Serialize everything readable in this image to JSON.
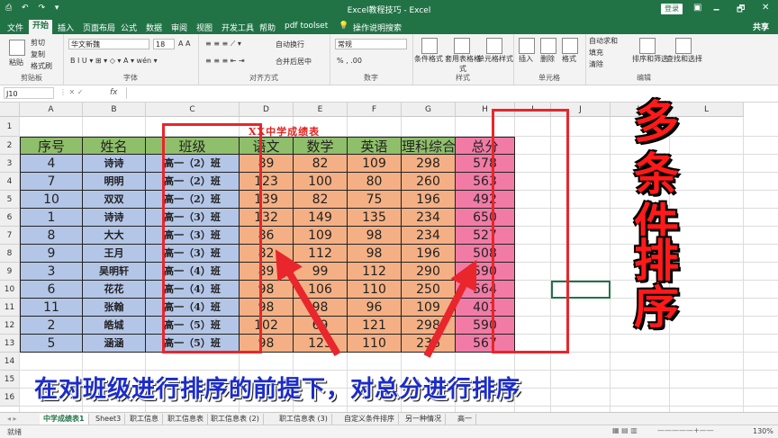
{
  "window": {
    "title": "Excel教程技巧 - Excel",
    "login": "登录",
    "quick_access": "⎙ ↶ ↷ ▾",
    "controls": [
      "🗕",
      "🗗",
      "✕"
    ]
  },
  "ribbon_tabs": [
    "文件",
    "开始",
    "插入",
    "页面布局",
    "公式",
    "数据",
    "审阅",
    "视图",
    "开发工具",
    "帮助",
    "pdf toolset"
  ],
  "tell_me": "操作说明搜索",
  "share": "共享",
  "ribbon": {
    "clipboard": {
      "label": "剪贴板",
      "paste": "粘贴",
      "cut": "剪切",
      "copy": "复制",
      "format_painter": "格式刷"
    },
    "font": {
      "label": "字体",
      "font_name": "华文新魏",
      "font_size": "18",
      "buttons": "B  I  U ▾  ⊞ ▾  ◇ ▾  A ▾  wén ▾"
    },
    "alignment": {
      "label": "对齐方式",
      "wrap": "自动换行",
      "merge": "合并后居中"
    },
    "number": {
      "label": "数字",
      "format": "常规",
      "symbols": "% , .00"
    },
    "styles": {
      "label": "样式",
      "conditional": "条件格式",
      "table": "套用表格格式",
      "cell_styles": "单元格样式"
    },
    "cells": {
      "label": "单元格",
      "insert": "插入",
      "delete": "删除",
      "format": "格式"
    },
    "editing": {
      "label": "编辑",
      "autosum": "自动求和",
      "fill": "填充",
      "clear": "清除",
      "sort": "排序和筛选",
      "find": "查找和选择"
    }
  },
  "formula_bar": {
    "name_box": "J10",
    "fx": "fx",
    "value": ""
  },
  "columns": [
    "A",
    "B",
    "C",
    "D",
    "E",
    "F",
    "G",
    "H",
    "I",
    "J",
    "K",
    "L"
  ],
  "rows": [
    "1",
    "2",
    "3",
    "4",
    "5",
    "6",
    "7",
    "8",
    "9",
    "10",
    "11",
    "12",
    "13",
    "14",
    "15",
    "16"
  ],
  "sheet_title": "XX中学成绩表",
  "table_headers": [
    "序号",
    "姓名",
    "班级",
    "语文",
    "数学",
    "英语",
    "理科综合",
    "总分"
  ],
  "table_rows": [
    [
      "4",
      "诗诗",
      "高一（2）班",
      "89",
      "82",
      "109",
      "298",
      "578"
    ],
    [
      "7",
      "明明",
      "高一（2）班",
      "123",
      "100",
      "80",
      "260",
      "563"
    ],
    [
      "10",
      "双双",
      "高一（2）班",
      "139",
      "82",
      "75",
      "196",
      "492"
    ],
    [
      "1",
      "诗诗",
      "高一（3）班",
      "132",
      "149",
      "135",
      "234",
      "650"
    ],
    [
      "8",
      "大大",
      "高一（3）班",
      "86",
      "109",
      "98",
      "234",
      "527"
    ],
    [
      "9",
      "王月",
      "高一（3）班",
      "82",
      "112",
      "98",
      "196",
      "508"
    ],
    [
      "3",
      "吴明轩",
      "高一（4）班",
      "89",
      "99",
      "112",
      "290",
      "590"
    ],
    [
      "6",
      "花花",
      "高一（4）班",
      "98",
      "106",
      "110",
      "250",
      "564"
    ],
    [
      "11",
      "张翰",
      "高一（4）班",
      "98",
      "98",
      "96",
      "109",
      "401"
    ],
    [
      "2",
      "皓城",
      "高一（5）班",
      "102",
      "69",
      "121",
      "298",
      "590"
    ],
    [
      "5",
      "涵涵",
      "高一（5）班",
      "98",
      "123",
      "110",
      "236",
      "567"
    ]
  ],
  "overlay": {
    "vertical_title": [
      "多",
      "条",
      "件",
      "排",
      "序"
    ],
    "banner": "在对班级进行排序的前提下，对总分进行排序"
  },
  "sheet_tabs": [
    "中学成绩表1",
    "Sheet3",
    "职工信息",
    "职工信息表",
    "职工信息表 (2)",
    "职工信息表 (3)",
    "自定义条件排序",
    "另一种情况",
    "高一"
  ],
  "status": {
    "left": "就绪",
    "zoom": "130%"
  },
  "colors": {
    "header_green": "#8fbf6a",
    "left_blue": "#b4c6e7",
    "score_orange": "#f4b084",
    "total_pink": "#f27ba6",
    "red_box": "#e8262c",
    "excel_green": "#217346"
  }
}
